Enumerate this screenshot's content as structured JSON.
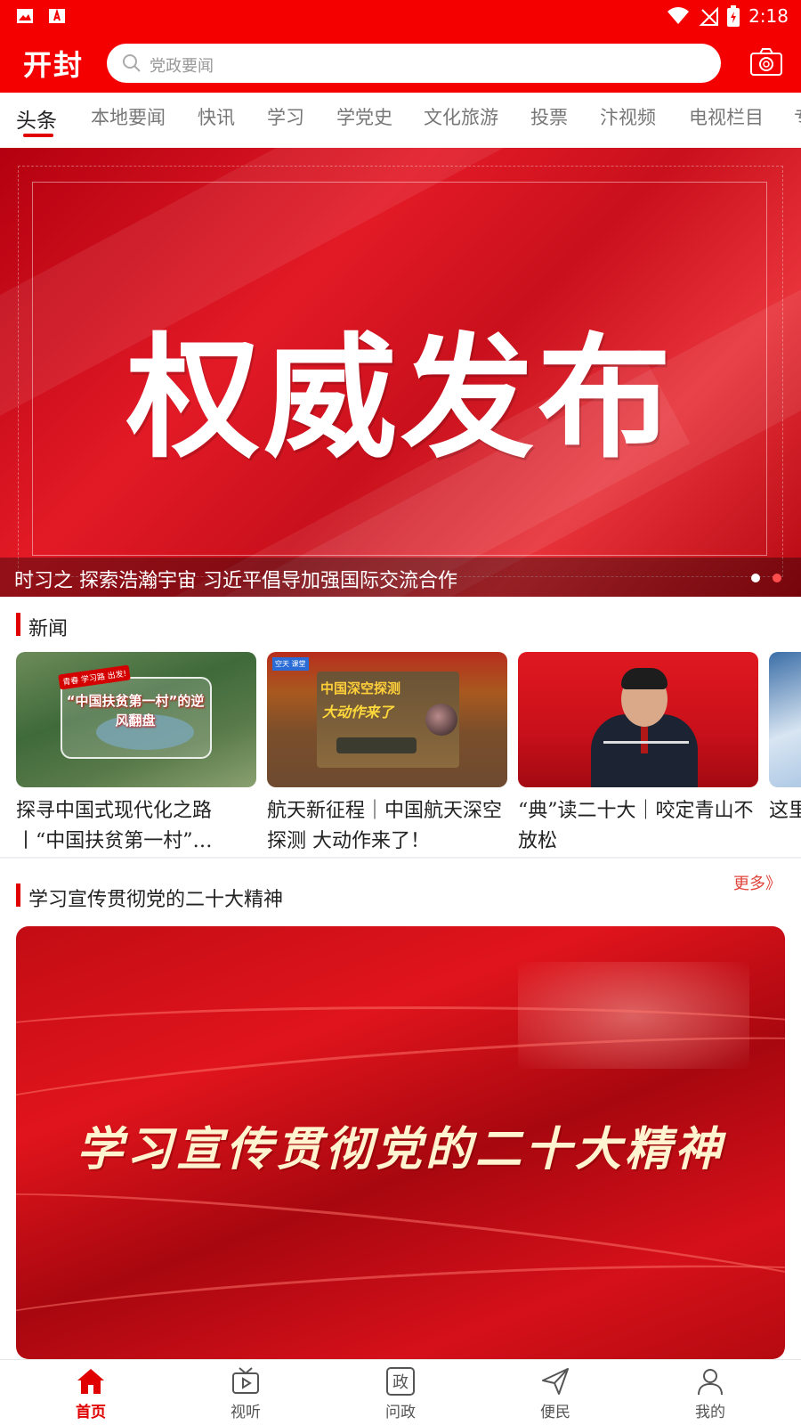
{
  "status_bar": {
    "time": "2:18"
  },
  "header": {
    "logo": "开封",
    "search_placeholder": "党政要闻"
  },
  "tabs": [
    "头条",
    "本地要闻",
    "快讯",
    "学习",
    "学党史",
    "文化旅游",
    "投票",
    "汴视频",
    "电视栏目",
    "专"
  ],
  "active_tab": "头条",
  "banner": {
    "title": "权威发布",
    "caption": "时习之 探索浩瀚宇宙 习近平倡导加强国际交流合作",
    "slide_count": 2,
    "active_slide": 2
  },
  "news_section": {
    "title": "新闻",
    "items": [
      {
        "title": "探寻中国式现代化之路丨“中国扶贫第一村”…",
        "image_text": "“中国扶贫第一村”的逆风翻盘",
        "image_badge": "青春 学习路 出发!"
      },
      {
        "title": "航天新征程｜中国航天深空探测 大动作来了！",
        "image_text_1": "中国深空探测",
        "image_text_2": "大动作来了",
        "image_badge": "空天 课堂"
      },
      {
        "title": "“典”读二十大｜咬定青山不放松"
      },
      {
        "title": "这里 入口"
      }
    ]
  },
  "study_section": {
    "title": "学习宣传贯彻党的二十大精神",
    "more_label": "更多》",
    "feature_title": "学习宣传贯彻党的二十大精神"
  },
  "bottom_nav": [
    {
      "label": "首页",
      "icon": "home-icon",
      "active": true
    },
    {
      "label": "视听",
      "icon": "tv-icon",
      "active": false
    },
    {
      "label": "问政",
      "icon": "zheng-icon",
      "active": false
    },
    {
      "label": "便民",
      "icon": "send-icon",
      "active": false
    },
    {
      "label": "我的",
      "icon": "user-icon",
      "active": false
    }
  ],
  "colors": {
    "brand_red": "#f50000",
    "accent_red": "#e00000",
    "more_red": "#e0443a"
  }
}
